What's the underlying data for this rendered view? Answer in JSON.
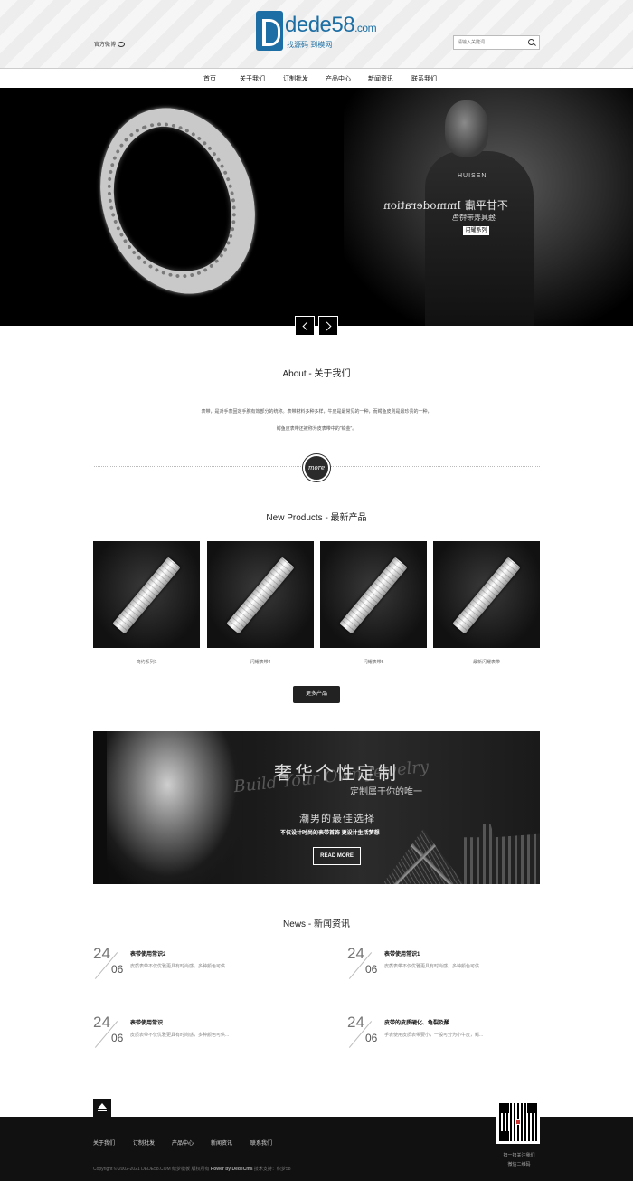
{
  "header": {
    "weibo_label": "官方微博",
    "logo_brand": "dede58",
    "logo_suffix": ".com",
    "logo_slogan": "找源码 到模网",
    "search_placeholder": "请输入关键词"
  },
  "nav": [
    "首页",
    "关于我们",
    "订制批发",
    "产品中心",
    "新闻资讯",
    "联系我们"
  ],
  "banner": {
    "brand": "HUISEN",
    "line1": "不甘平庸 Immoderation",
    "line2": "独具表带特色",
    "button": "闪耀系列"
  },
  "about": {
    "title": "About - 关于我们",
    "text1": "表带，是对手表固定手腕有效部分的统称。表带材料多种多样，牛皮是最常见的一种，而鳄鱼皮则是最珍贵的一种，",
    "text2": "鳄鱼皮表带还被称为皮表带中的\"铂金\"。",
    "more": "more"
  },
  "products": {
    "title": "New Products - 最新产品",
    "items": [
      "-简约系列1-",
      "-闪耀表带4-",
      "-闪耀表带5-",
      "-最新闪耀表带-"
    ],
    "more_button": "更多产品"
  },
  "promo": {
    "title": "奢华个性定制",
    "script": "Build Your Own Jewelry",
    "subtitle": "定制属于你的唯一",
    "best": "潮男的最佳选择",
    "desc": "不仅设计时尚的表带首饰   更设计生活梦想",
    "button": "READ MORE"
  },
  "news": {
    "title": "News - 新闻资讯",
    "items": [
      {
        "day": "24",
        "month": "06",
        "title": "表带使用常识2",
        "desc": "皮质表带不仅优雅更具有时尚感，多种颜色可供..."
      },
      {
        "day": "24",
        "month": "06",
        "title": "表带使用常识1",
        "desc": "皮质表带不仅优雅更具有时尚感，多种颜色可供..."
      },
      {
        "day": "24",
        "month": "06",
        "title": "表带使用常识",
        "desc": "皮质表带不仅优雅更具有时尚感，多种颜色可供..."
      },
      {
        "day": "24",
        "month": "06",
        "title": "皮带的皮质硬化、龟裂及酸",
        "desc": "手表使用皮质表带要小，一般可分为小牛皮，鳄..."
      }
    ]
  },
  "footer": {
    "links": [
      "关于我们",
      "订制批发",
      "产品中心",
      "新闻资讯",
      "联系我们"
    ],
    "copyright_prefix": "Copyright © 2002-2021 DEDE58.COM 织梦模板 版权所有",
    "power": "Power by DedeCms",
    "support": "技术支持：织梦58",
    "qr_line1": "扫一扫关注我们",
    "qr_line2": "微信二维码"
  }
}
